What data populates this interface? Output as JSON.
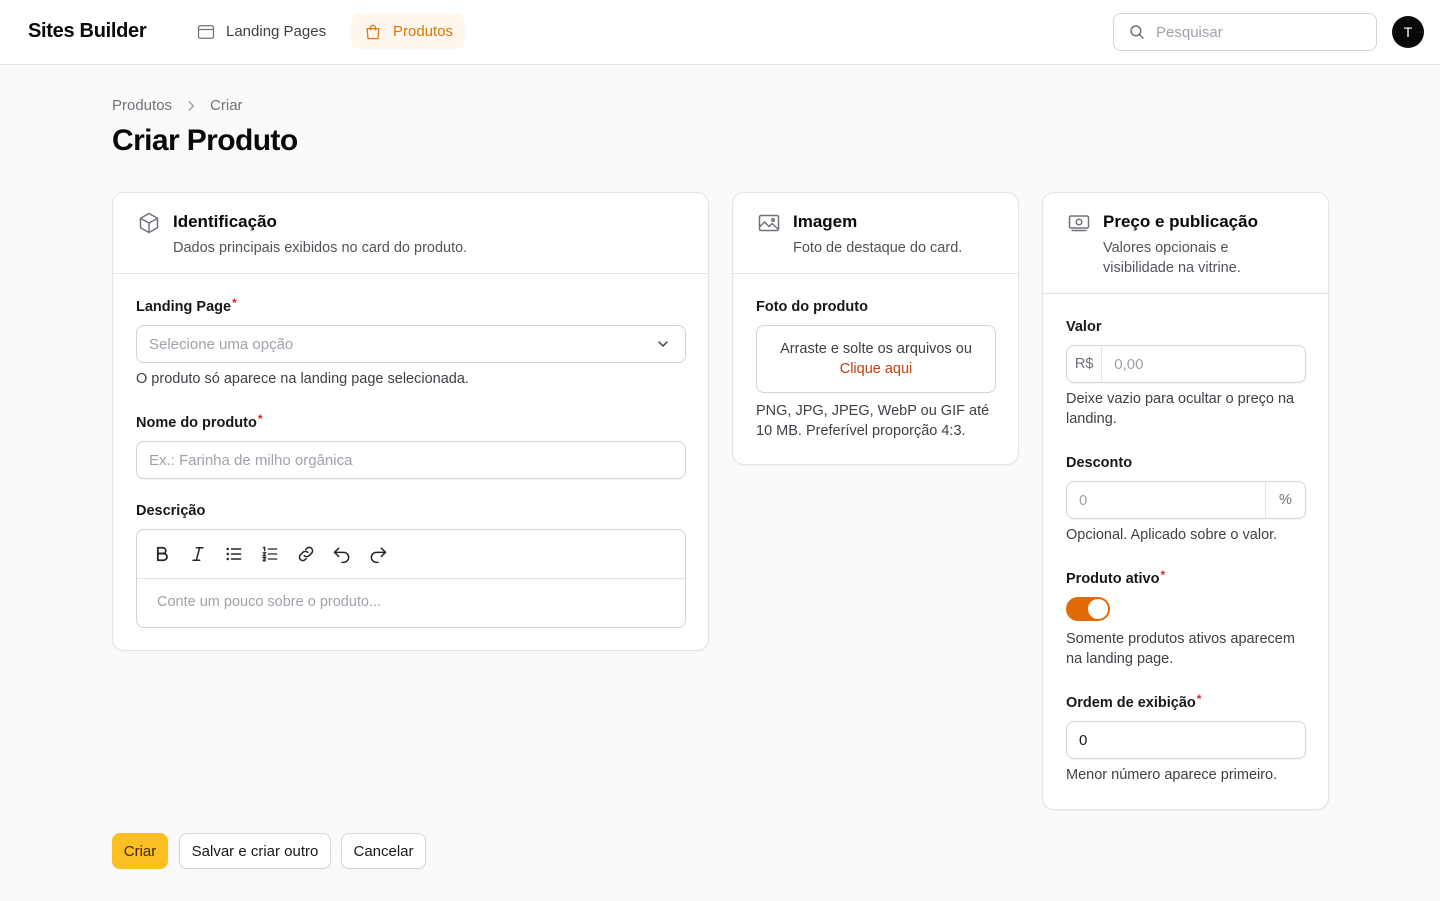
{
  "app": {
    "brand": "Sites Builder",
    "avatar_initial": "T"
  },
  "nav": {
    "landing_pages": "Landing Pages",
    "produtos": "Produtos",
    "search_placeholder": "Pesquisar"
  },
  "breadcrumb": {
    "root": "Produtos",
    "current": "Criar"
  },
  "page_title": "Criar Produto",
  "identificacao": {
    "title": "Identificação",
    "description": "Dados principais exibidos no card do produto.",
    "landing_page_label": "Landing Page",
    "landing_page_placeholder": "Selecione uma opção",
    "landing_page_hint": "O produto só aparece na landing page selecionada.",
    "nome_label": "Nome do produto",
    "nome_placeholder": "Ex.: Farinha de milho orgânica",
    "descricao_label": "Descrição",
    "descricao_placeholder": "Conte um pouco sobre o produto..."
  },
  "imagem": {
    "title": "Imagem",
    "description": "Foto de destaque do card.",
    "foto_label": "Foto do produto",
    "dropzone_text": "Arraste e solte os arquivos ou",
    "dropzone_link": "Clique aqui",
    "hint": "PNG, JPG, JPEG, WebP ou GIF até 10 MB. Preferível proporção 4:3."
  },
  "preco": {
    "title": "Preço e publicação",
    "description": "Valores opcionais e visibilidade na vitrine.",
    "valor_label": "Valor",
    "valor_prefix": "R$",
    "valor_placeholder": "0,00",
    "valor_hint": "Deixe vazio para ocultar o preço na landing.",
    "desconto_label": "Desconto",
    "desconto_placeholder": "0",
    "desconto_suffix": "%",
    "desconto_hint": "Opcional. Aplicado sobre o valor.",
    "ativo_label": "Produto ativo",
    "ativo_value": true,
    "ativo_hint": "Somente produtos ativos aparecem na landing page.",
    "ordem_label": "Ordem de exibição",
    "ordem_value": "0",
    "ordem_hint": "Menor número aparece primeiro."
  },
  "actions": {
    "criar": "Criar",
    "salvar_criar_outro": "Salvar e criar outro",
    "cancelar": "Cancelar"
  },
  "colors": {
    "accent": "#d97706",
    "primary_button": "#fbbf24",
    "toggle_on": "#e26a06",
    "required": "#dc2626"
  }
}
